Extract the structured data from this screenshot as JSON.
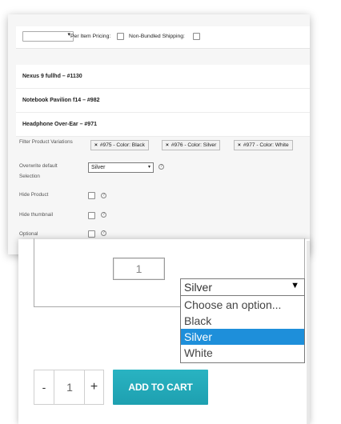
{
  "admin": {
    "per_item_pricing_label": "Per Item Pricing:",
    "non_bundled_shipping_label": "Non-Bundled Shipping:",
    "bundled_items": [
      {
        "title": "Nexus 9 fullhd – #1130"
      },
      {
        "title": "Notebook Pavilion f14 – #982"
      },
      {
        "title": "Headphone Over-Ear – #971"
      }
    ],
    "filter_label": "Filter Product Variations",
    "variation_tags": [
      {
        "remove": "×",
        "text": "#975 - Color: Black"
      },
      {
        "remove": "×",
        "text": "#976 - Color: Silver"
      },
      {
        "remove": "×",
        "text": "#977 - Color: White"
      }
    ],
    "overwrite_label_1": "Overwrite default",
    "overwrite_label_2": "Selection",
    "overwrite_value": "Silver",
    "hide_product_label": "Hide Product",
    "hide_thumbnail_label": "Hide thumbnail",
    "optional_label": "Optional",
    "help_glyph": "?",
    "arrow_glyph": "▾"
  },
  "product": {
    "qty_field_value": "1",
    "variation_select": {
      "selected": "Silver",
      "arrow": "▼",
      "options": [
        "Choose an option...",
        "Black",
        "Silver",
        "White"
      ],
      "highlighted_index": 2
    },
    "stepper": {
      "minus": "-",
      "value": "1",
      "plus": "+"
    },
    "add_to_cart_label": "ADD TO CART",
    "colors": {
      "accent": "#1fa5b5",
      "highlight": "#1e8fda"
    }
  }
}
